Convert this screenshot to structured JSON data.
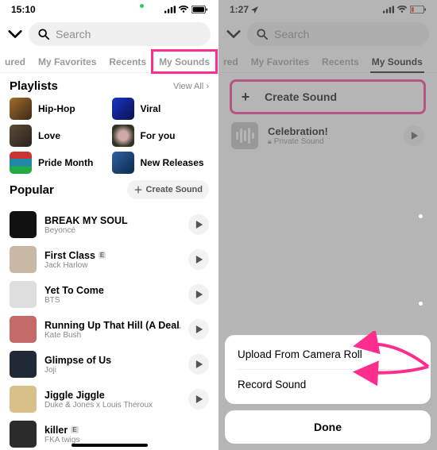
{
  "left": {
    "status": {
      "time": "15:10"
    },
    "search": {
      "placeholder": "Search"
    },
    "tabs": {
      "featured_partial": "ured",
      "favorites": "My Favorites",
      "recents": "Recents",
      "sounds": "My Sounds"
    },
    "playlists": {
      "title": "Playlists",
      "viewall": "View All",
      "items": [
        {
          "label": "Hip-Hop"
        },
        {
          "label": "Viral"
        },
        {
          "label": "Love"
        },
        {
          "label": "For you"
        },
        {
          "label": "Pride Month"
        },
        {
          "label": "New Releases"
        }
      ]
    },
    "popular": {
      "title": "Popular",
      "create": "Create Sound",
      "songs": [
        {
          "title": "BREAK MY SOUL",
          "artist": "Beyoncé",
          "explicit": false
        },
        {
          "title": "First Class",
          "artist": "Jack Harlow",
          "explicit": true
        },
        {
          "title": "Yet To Come",
          "artist": "BTS",
          "explicit": false
        },
        {
          "title": "Running Up That Hill (A Deal...",
          "artist": "Kate Bush",
          "explicit": false
        },
        {
          "title": "Glimpse of Us",
          "artist": "Joji",
          "explicit": false
        },
        {
          "title": "Jiggle Jiggle",
          "artist": "Duke & Jones x Louis Theroux",
          "explicit": false
        },
        {
          "title": "killer",
          "artist": "FKA twigs",
          "explicit": true
        }
      ]
    }
  },
  "right": {
    "status": {
      "time": "1:27"
    },
    "search": {
      "placeholder": "Search"
    },
    "tabs": {
      "featured_partial": "red",
      "favorites": "My Favorites",
      "recents": "Recents",
      "sounds": "My Sounds",
      "active": "sounds"
    },
    "create": "Create Sound",
    "song": {
      "title": "Celebration!",
      "sub": "Private Sound"
    },
    "sheet": {
      "opt1": "Upload From Camera Roll",
      "opt2": "Record Sound",
      "done": "Done"
    }
  }
}
